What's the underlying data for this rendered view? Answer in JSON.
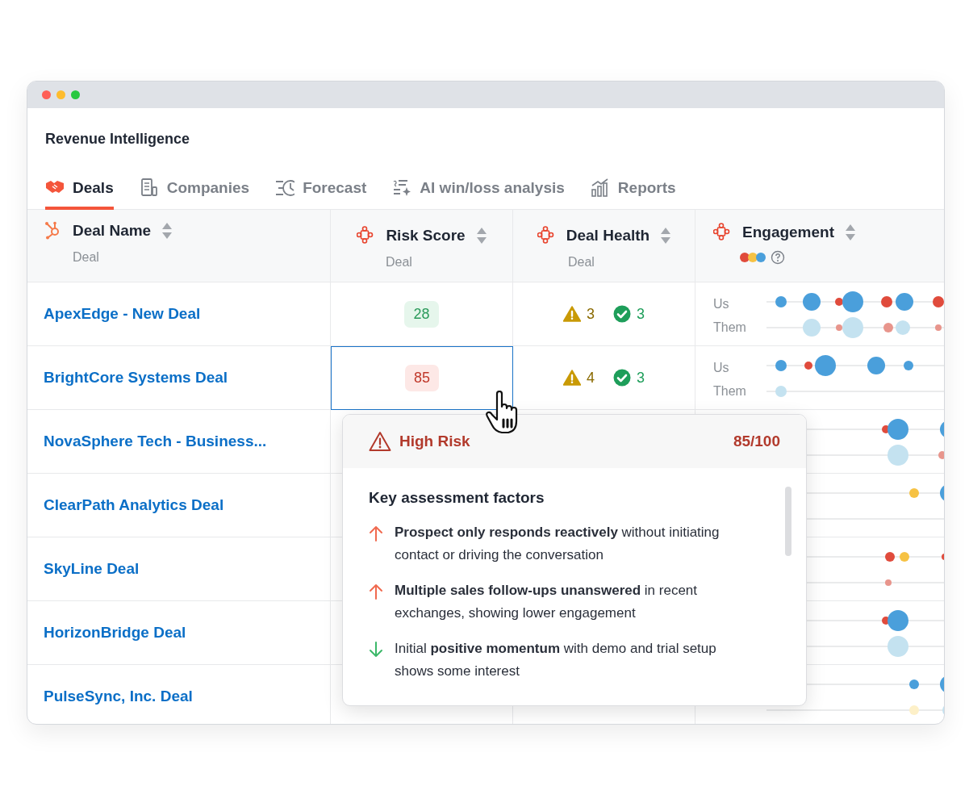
{
  "window": {
    "title": "Revenue Intelligence"
  },
  "tabs": [
    {
      "label": "Deals",
      "selected": true
    },
    {
      "label": "Companies",
      "selected": false
    },
    {
      "label": "Forecast",
      "selected": false
    },
    {
      "label": "AI win/loss analysis",
      "selected": false
    },
    {
      "label": "Reports",
      "selected": false
    }
  ],
  "table": {
    "columns": [
      {
        "title": "Deal Name",
        "subtitle": "Deal"
      },
      {
        "title": "Risk Score",
        "subtitle": "Deal"
      },
      {
        "title": "Deal Health",
        "subtitle": "Deal"
      },
      {
        "title": "Engagement"
      }
    ],
    "rows": [
      {
        "name": "ApexEdge - New Deal",
        "risk": {
          "score": "28",
          "kind": "low",
          "selected": false
        },
        "health": {
          "warnings": "3",
          "passes": "3"
        },
        "engagement_labels": [
          "Us",
          "Them"
        ]
      },
      {
        "name": "BrightCore Systems Deal",
        "risk": {
          "score": "85",
          "kind": "high",
          "selected": true
        },
        "health": {
          "warnings": "4",
          "passes": "3"
        },
        "engagement_labels": [
          "Us",
          "Them"
        ]
      },
      {
        "name": "NovaSphere Tech - Business..."
      },
      {
        "name": "ClearPath Analytics Deal"
      },
      {
        "name": "SkyLine Deal"
      },
      {
        "name": "HorizonBridge Deal"
      },
      {
        "name": "PulseSync, Inc. Deal"
      }
    ]
  },
  "popover": {
    "title": "High Risk",
    "score": "85/100",
    "heading": "Key assessment factors",
    "factors": [
      {
        "kind": "up",
        "text": "**Prospect only responds reactively** without initiating contact or driving the conversation"
      },
      {
        "kind": "up",
        "text": "**Multiple sales follow-ups unanswered** in recent exchanges, showing lower engagement"
      },
      {
        "kind": "down",
        "text": "Initial **positive momentum** with demo and trial setup shows some interest"
      }
    ]
  }
}
